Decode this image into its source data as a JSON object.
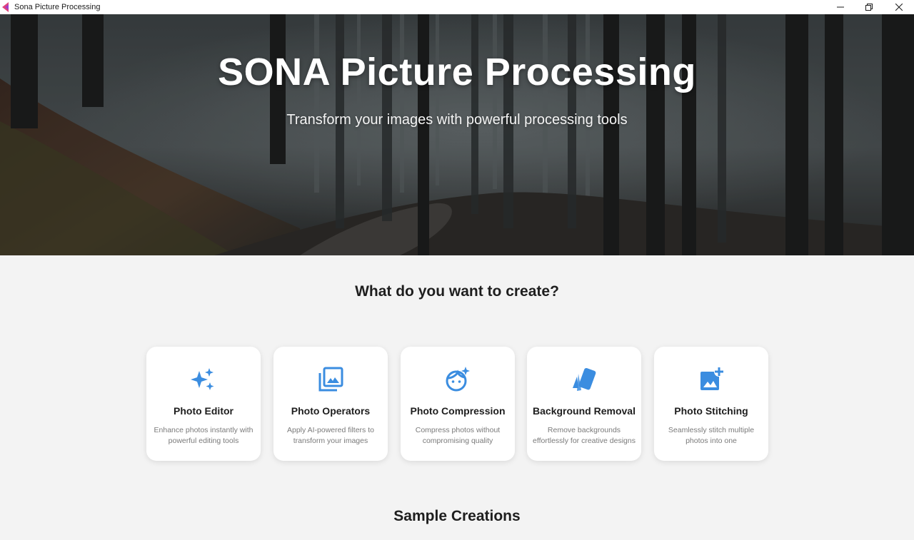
{
  "window": {
    "title": "Sona Picture Processing"
  },
  "hero": {
    "title": "SONA Picture Processing",
    "subtitle": "Transform your images with powerful processing tools"
  },
  "create_section": {
    "title": "What do you want to create?",
    "cards": [
      {
        "icon": "sparkles-icon",
        "name": "Photo Editor",
        "description": "Enhance photos instantly with powerful editing tools"
      },
      {
        "icon": "image-stack-icon",
        "name": "Photo Operators",
        "description": "Apply AI-powered filters to transform your images"
      },
      {
        "icon": "face-sparkle-icon",
        "name": "Photo Compression",
        "description": "Compress photos without compromising quality"
      },
      {
        "icon": "layers-cards-icon",
        "name": "Background Removal",
        "description": "Remove backgrounds effortlessly for creative designs"
      },
      {
        "icon": "image-add-icon",
        "name": "Photo Stitching",
        "description": "Seamlessly stitch multiple photos into one"
      }
    ]
  },
  "samples_section": {
    "title": "Sample Creations"
  },
  "colors": {
    "accent": "#3b8de0",
    "background": "#f3f3f3",
    "card": "#ffffff"
  }
}
